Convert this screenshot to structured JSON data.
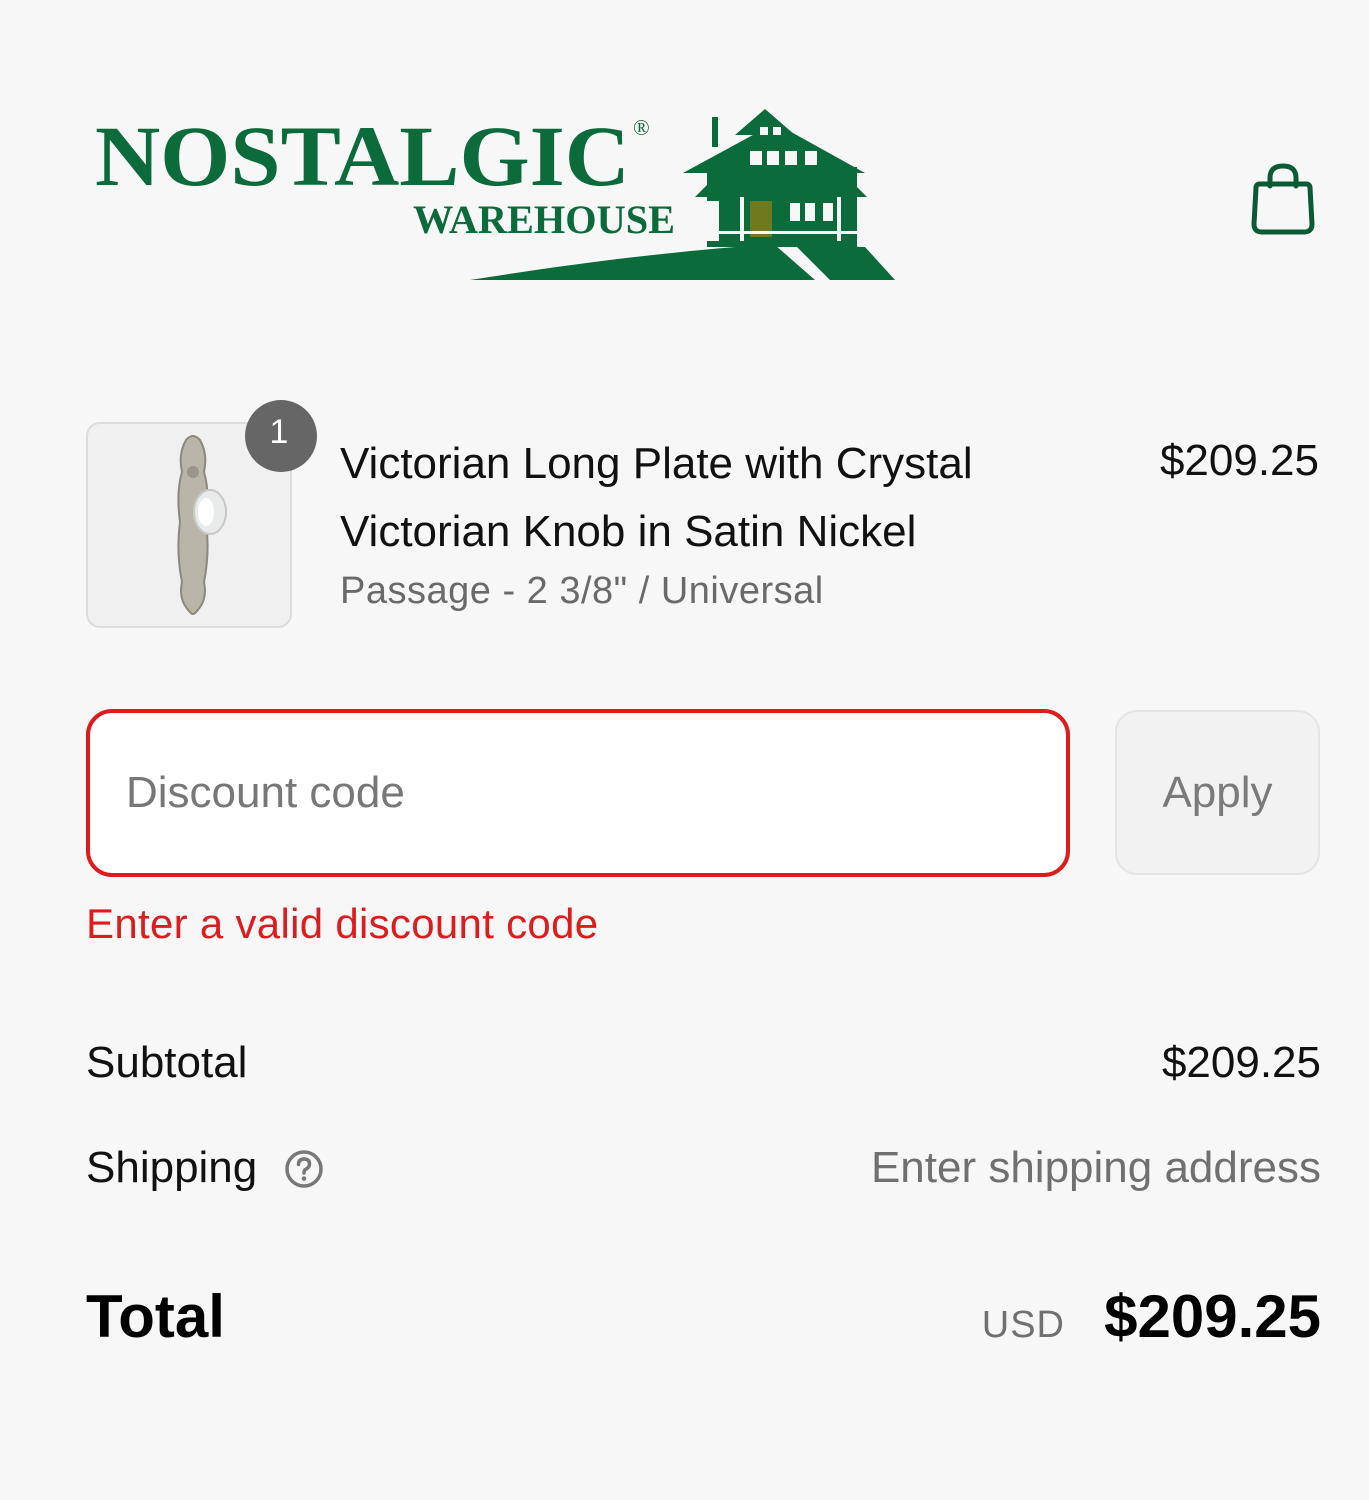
{
  "header": {
    "logo": {
      "line1": "NOSTALGIC",
      "line2": "WAREHOUSE",
      "registered": "®"
    },
    "cart_icon": "shopping-bag-icon"
  },
  "colors": {
    "brand_green": "#0b6b3a",
    "error_red": "#dd1d1d",
    "muted_text": "#707070"
  },
  "line_item": {
    "quantity": "1",
    "title": "Victorian Long Plate with Crystal Victorian Knob in Satin Nickel",
    "variant": "Passage - 2 3/8\" / Universal",
    "price": "$209.25"
  },
  "discount": {
    "placeholder": "Discount code",
    "value": "",
    "apply_label": "Apply",
    "error": "Enter a valid discount code"
  },
  "summary": {
    "subtotal_label": "Subtotal",
    "subtotal_value": "$209.25",
    "shipping_label": "Shipping",
    "shipping_help_icon": "question-circle-icon",
    "shipping_value": "Enter shipping address",
    "total_label": "Total",
    "currency": "USD",
    "total_value": "$209.25"
  }
}
